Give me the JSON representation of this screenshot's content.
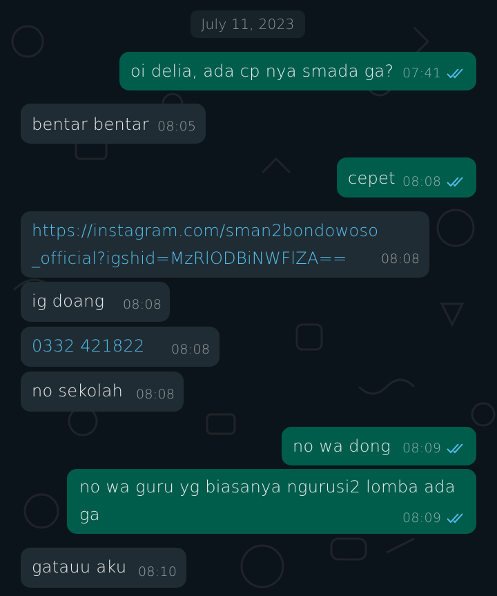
{
  "date_chip": "July 11, 2023",
  "messages": [
    {
      "dir": "out",
      "text": "oi delia, ada cp nya smada ga?",
      "time": "07:41"
    },
    {
      "dir": "in",
      "text": "bentar bentar",
      "time": "08:05"
    },
    {
      "dir": "out",
      "text": "cepet",
      "time": "08:08"
    },
    {
      "dir": "in",
      "text": "https://instagram.com/sman2bondowoso\n_official?igshid=MzRlODBiNWFlZA==",
      "time": "08:08"
    },
    {
      "dir": "in",
      "text": "ig doang",
      "time": "08:08"
    },
    {
      "dir": "in",
      "text": "0332 421822",
      "time": "08:08"
    },
    {
      "dir": "in",
      "text": "no sekolah",
      "time": "08:08"
    },
    {
      "dir": "out",
      "text": "no wa dong",
      "time": "08:09"
    },
    {
      "dir": "out",
      "text": "no wa guru yg biasanya ngurusi2 lomba ada\nga",
      "time": "08:09"
    },
    {
      "dir": "in",
      "text": "gatauu aku",
      "time": "08:10"
    }
  ],
  "colors": {
    "background": "#0b141a",
    "incoming_bubble": "#202c33",
    "outgoing_bubble": "#005c4b",
    "link": "#53bdeb",
    "read_tick": "#53bdeb"
  },
  "icons": {
    "read_receipt": "double-check-icon"
  }
}
